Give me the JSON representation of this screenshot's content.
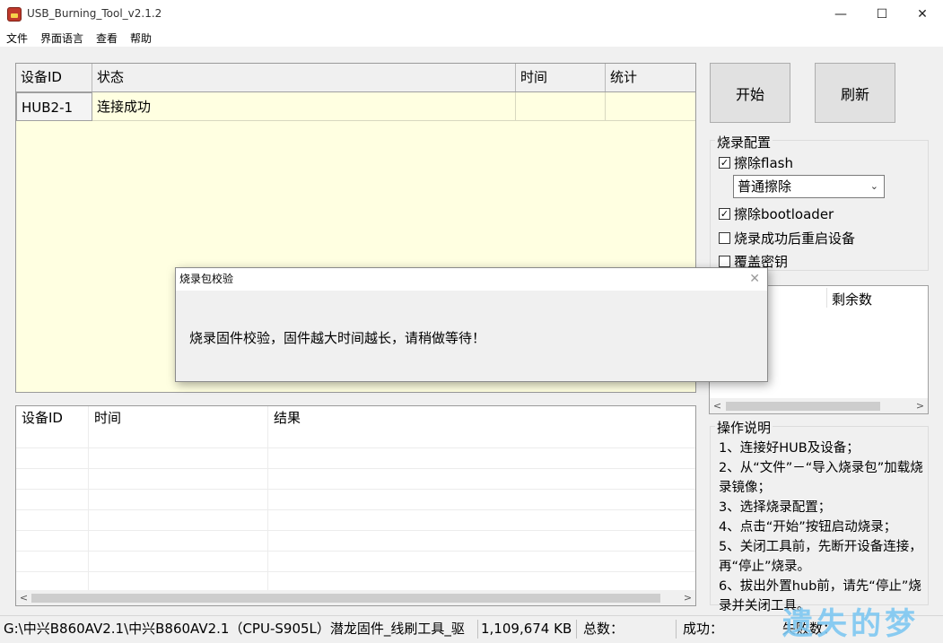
{
  "window": {
    "title": "USB_Burning_Tool_v2.1.2",
    "minimize": "—",
    "maximize": "☐",
    "close": "✕"
  },
  "menu": [
    "文件",
    "界面语言",
    "查看",
    "帮助"
  ],
  "device_table": {
    "headers": [
      "设备ID",
      "状态",
      "时间",
      "统计"
    ],
    "rows": [
      {
        "id": "HUB2-1",
        "status": "连接成功",
        "time": "",
        "stats": ""
      }
    ]
  },
  "buttons": {
    "start": "开始",
    "refresh": "刷新"
  },
  "burn_config": {
    "title": "烧录配置",
    "erase_flash": {
      "label": "擦除flash",
      "checked": true
    },
    "erase_mode": "普通擦除",
    "erase_bootloader": {
      "label": "擦除bootloader",
      "checked": true
    },
    "reboot_after": {
      "label": "烧录成功后重启设备",
      "checked": false
    },
    "overwrite_key": {
      "label": "覆盖密钥",
      "checked": false
    }
  },
  "stat_list": {
    "header_remaining": "剩余数"
  },
  "instructions": {
    "title": "操作说明",
    "lines": [
      "1、连接好HUB及设备；",
      "2、从“文件”－“导入烧录包”加载烧录镜像；",
      "3、选择烧录配置；",
      "4、点击“开始”按钮启动烧录；",
      "5、关闭工具前，先断开设备连接，再“停止”烧录。",
      "6、拔出外置hub前，请先“停止”烧录并关闭工具。"
    ]
  },
  "result_table": {
    "headers": [
      "设备ID",
      "时间",
      "结果"
    ]
  },
  "statusbar": {
    "path": "G:\\中兴B860AV2.1\\中兴B860AV2.1（CPU-S905L）潜龙固件_线刷工具_驱",
    "size": "1,109,674 KB",
    "total_label": "总数：",
    "success_label": "成功：",
    "fail_label": "失败数："
  },
  "dialog": {
    "title": "烧录包校验",
    "message": "烧录固件校验，固件越大时间越长，请稍做等待！",
    "close": "✕"
  },
  "watermark": "遗失的梦"
}
